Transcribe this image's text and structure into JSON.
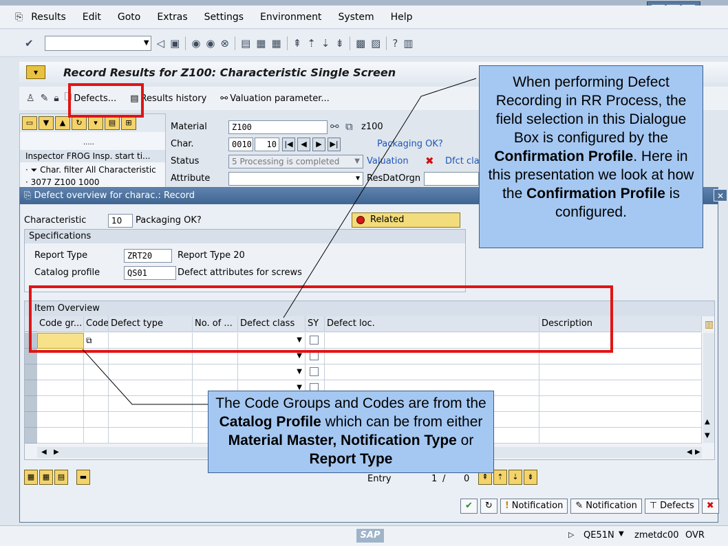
{
  "menubar": {
    "items": [
      "Results",
      "Edit",
      "Goto",
      "Extras",
      "Settings",
      "Environment",
      "System",
      "Help"
    ]
  },
  "window": {
    "title": "Record Results for Z100: Characteristic Single Screen"
  },
  "app_toolbar": {
    "defects": "Defects...",
    "results_history": "Results history",
    "valuation_param": "Valuation parameter..."
  },
  "tree": {
    "dots": ".....",
    "header": "Inspector FROG Insp. start ti...",
    "node1": "Char. filter All Characteristic",
    "node2": "3077  Z100  1000"
  },
  "header": {
    "material_label": "Material",
    "material_value": "Z100",
    "material_desc": "z100",
    "char_label": "Char.",
    "char_value": "0010",
    "char_no": "10",
    "char_desc": "Packaging OK?",
    "status_label": "Status",
    "status_value": "5 Processing is completed",
    "valuation_label": "Valuation",
    "dfct_class_label": "Dfct clas",
    "attribute_label": "Attribute",
    "resdat_label": "ResDatOrgn"
  },
  "dialog": {
    "title": "Defect overview for charac.: Record",
    "characteristic_label": "Characteristic",
    "characteristic_value": "10",
    "characteristic_desc": "Packaging OK?",
    "related_button": "Related Notifications",
    "spec_header": "Specifications",
    "report_type_label": "Report Type",
    "report_type_value": "ZRT20",
    "report_type_desc": "Report Type 20",
    "catalog_label": "Catalog profile",
    "catalog_value": "QS01",
    "catalog_desc": "Defect attributes for screws",
    "item_header": "Item Overview",
    "columns": [
      "Code gr...",
      "Code",
      "Defect type",
      "No. of ...",
      "Defect class",
      "SY",
      "Defect loc.",
      "Description"
    ],
    "entry_label": "Entry",
    "entry_current": "1",
    "entry_sep": "/",
    "entry_total": "0",
    "footer": {
      "notification1": "Notification",
      "notification2": "Notification",
      "defects": "Defects"
    }
  },
  "statusbar": {
    "sap_logo": "SAP",
    "transaction": "QE51N",
    "server": "zmetdc00",
    "mode": "OVR"
  },
  "callouts": {
    "top": {
      "t1": "When performing Defect Recording in RR Process, the field selection in this Dialogue Box is configured by the ",
      "b1": "Confirmation Profile",
      "t2": ". Here in this presentation we look at how the ",
      "b2": "Confirmation Profile",
      "t3": " is configured."
    },
    "bottom": {
      "t1": "The Code Groups and Codes are from the ",
      "b1": "Catalog Profile",
      "t2": " which can be from either ",
      "b2": "Material Master, Notification Type",
      "t3": " or ",
      "b3": "Report Type"
    }
  },
  "colors": {
    "highlight_red": "#e11414",
    "callout_blue": "#a5c8f2",
    "title_blue": "#3f6592"
  }
}
